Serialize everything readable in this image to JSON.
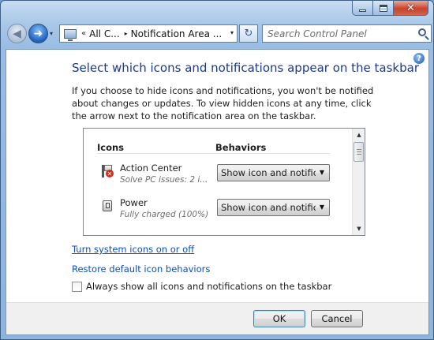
{
  "window": {
    "caption": {
      "close_glyph": "✕"
    }
  },
  "navbar": {
    "back_glyph": "◀",
    "forward_glyph": "➜",
    "history_dd_glyph": "▾",
    "address": {
      "chevron": "«",
      "segment1": "All C...",
      "arrow": "▸",
      "segment2": "Notification Area ...",
      "dropdown_glyph": "▾"
    },
    "refresh_glyph": "↻",
    "search": {
      "placeholder": "Search Control Panel"
    }
  },
  "help_glyph": "?",
  "page": {
    "title": "Select which icons and notifications appear on the taskbar",
    "description": "If you choose to hide icons and notifications, you won't be notified about changes or updates. To view hidden icons at any time, click the arrow next to the notification area on the taskbar."
  },
  "table": {
    "headers": {
      "icons": "Icons",
      "behaviors": "Behaviors"
    },
    "rows": [
      {
        "name": "Action Center",
        "subtitle": "Solve PC issues: 2 i...",
        "behavior": "Show icon and notificatic",
        "icon": "action-center-flag-icon"
      },
      {
        "name": "Power",
        "subtitle": "Fully charged (100%)",
        "behavior": "Show icon and notificatic",
        "icon": "power-plug-icon"
      }
    ],
    "dropdown_caret": "▼",
    "scroll_up": "▲",
    "scroll_down": "▼"
  },
  "links": {
    "system_icons": "Turn system icons on or off",
    "restore": "Restore default icon behaviors"
  },
  "checkbox": {
    "label": "Always show all icons and notifications on the taskbar",
    "checked": false
  },
  "buttons": {
    "ok": "OK",
    "cancel": "Cancel"
  }
}
